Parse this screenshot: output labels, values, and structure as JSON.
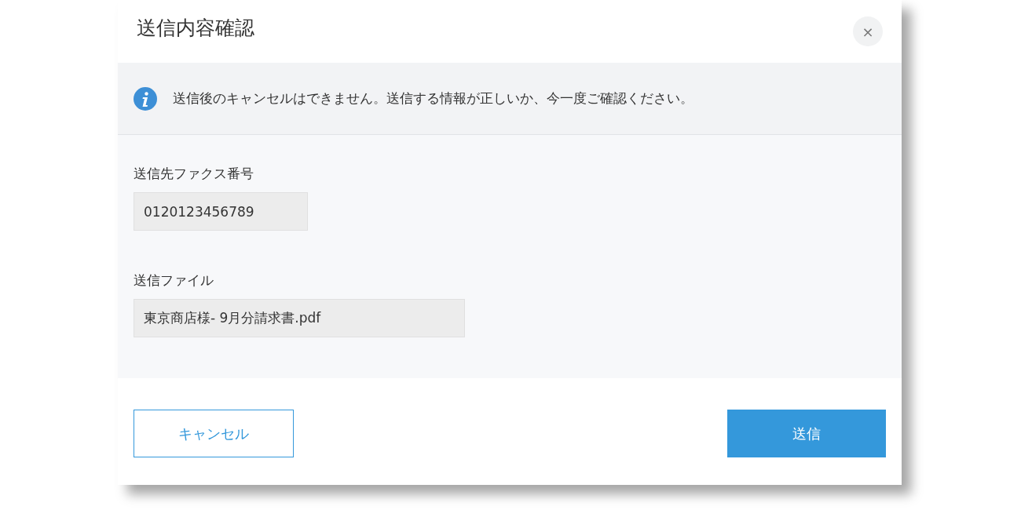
{
  "dialog": {
    "title": "送信内容確認",
    "close": "×"
  },
  "notice": {
    "text": "送信後のキャンセルはできません。送信する情報が正しいか、今一度ご確認ください。"
  },
  "fields": [
    {
      "label": "送信先ファクス番号",
      "value": "0120123456789"
    },
    {
      "label": "送信ファイル",
      "value": "東京商店様- 9月分請求書.pdf"
    }
  ],
  "buttons": [
    {
      "label": "キャンセル",
      "kind": "secondary"
    },
    {
      "label": "送信",
      "kind": "primary"
    }
  ]
}
